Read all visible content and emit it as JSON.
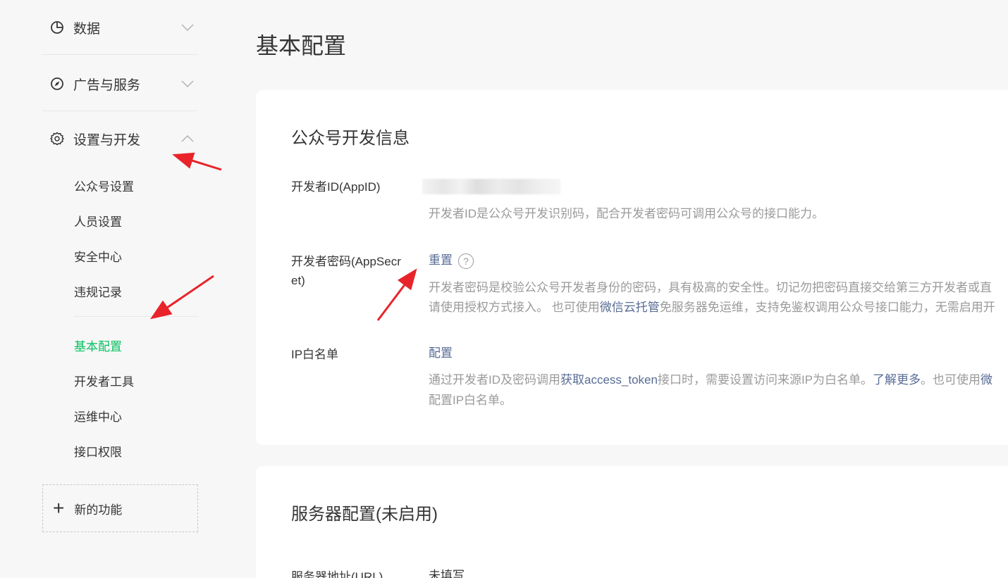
{
  "sidebar": {
    "groups": [
      {
        "label": "数据",
        "icon": "pie-chart-icon"
      },
      {
        "label": "广告与服务",
        "icon": "compass-icon"
      },
      {
        "label": "设置与开发",
        "icon": "gear-icon"
      }
    ],
    "sub_items": [
      "公众号设置",
      "人员设置",
      "安全中心",
      "违规记录",
      "基本配置",
      "开发者工具",
      "运维中心",
      "接口权限"
    ],
    "active_item": "基本配置",
    "new_feature_label": "新的功能"
  },
  "main": {
    "page_title": "基本配置",
    "dev_info": {
      "title": "公众号开发信息",
      "appid_label": "开发者ID(AppID)",
      "appid_desc": "开发者ID是公众号开发识别码，配合开发者密码可调用公众号的接口能力。",
      "secret_label": "开发者密码(AppSecret)",
      "secret_action": "重置",
      "secret_desc_line1": "开发者密码是校验公众号开发者身份的密码，具有极高的安全性。切记勿把密码直接交给第三方开发者或直",
      "secret_desc_line2_a": "请使用授权方式接入。 也可使用",
      "secret_desc_line2_link": "微信云托管",
      "secret_desc_line2_b": "免服务器免运维，支持免鉴权调用公众号接口能力，无需启用开",
      "ip_label": "IP白名单",
      "ip_action": "配置",
      "ip_desc_a": "通过开发者ID及密码调用",
      "ip_desc_link1": "获取access_token",
      "ip_desc_b": "接口时，需要设置访问来源IP为白名单。",
      "ip_desc_link2": "了解更多",
      "ip_desc_c": "。也可使用",
      "ip_desc_link3": "微",
      "ip_desc_line2": "配置IP白名单。"
    },
    "server_config": {
      "title": "服务器配置(未启用)",
      "url_label": "服务器地址(URL)",
      "url_value": "未填写"
    }
  },
  "colors": {
    "accent_green": "#07c160",
    "link_blue": "#576b95",
    "annotation_red": "#e8242a"
  }
}
